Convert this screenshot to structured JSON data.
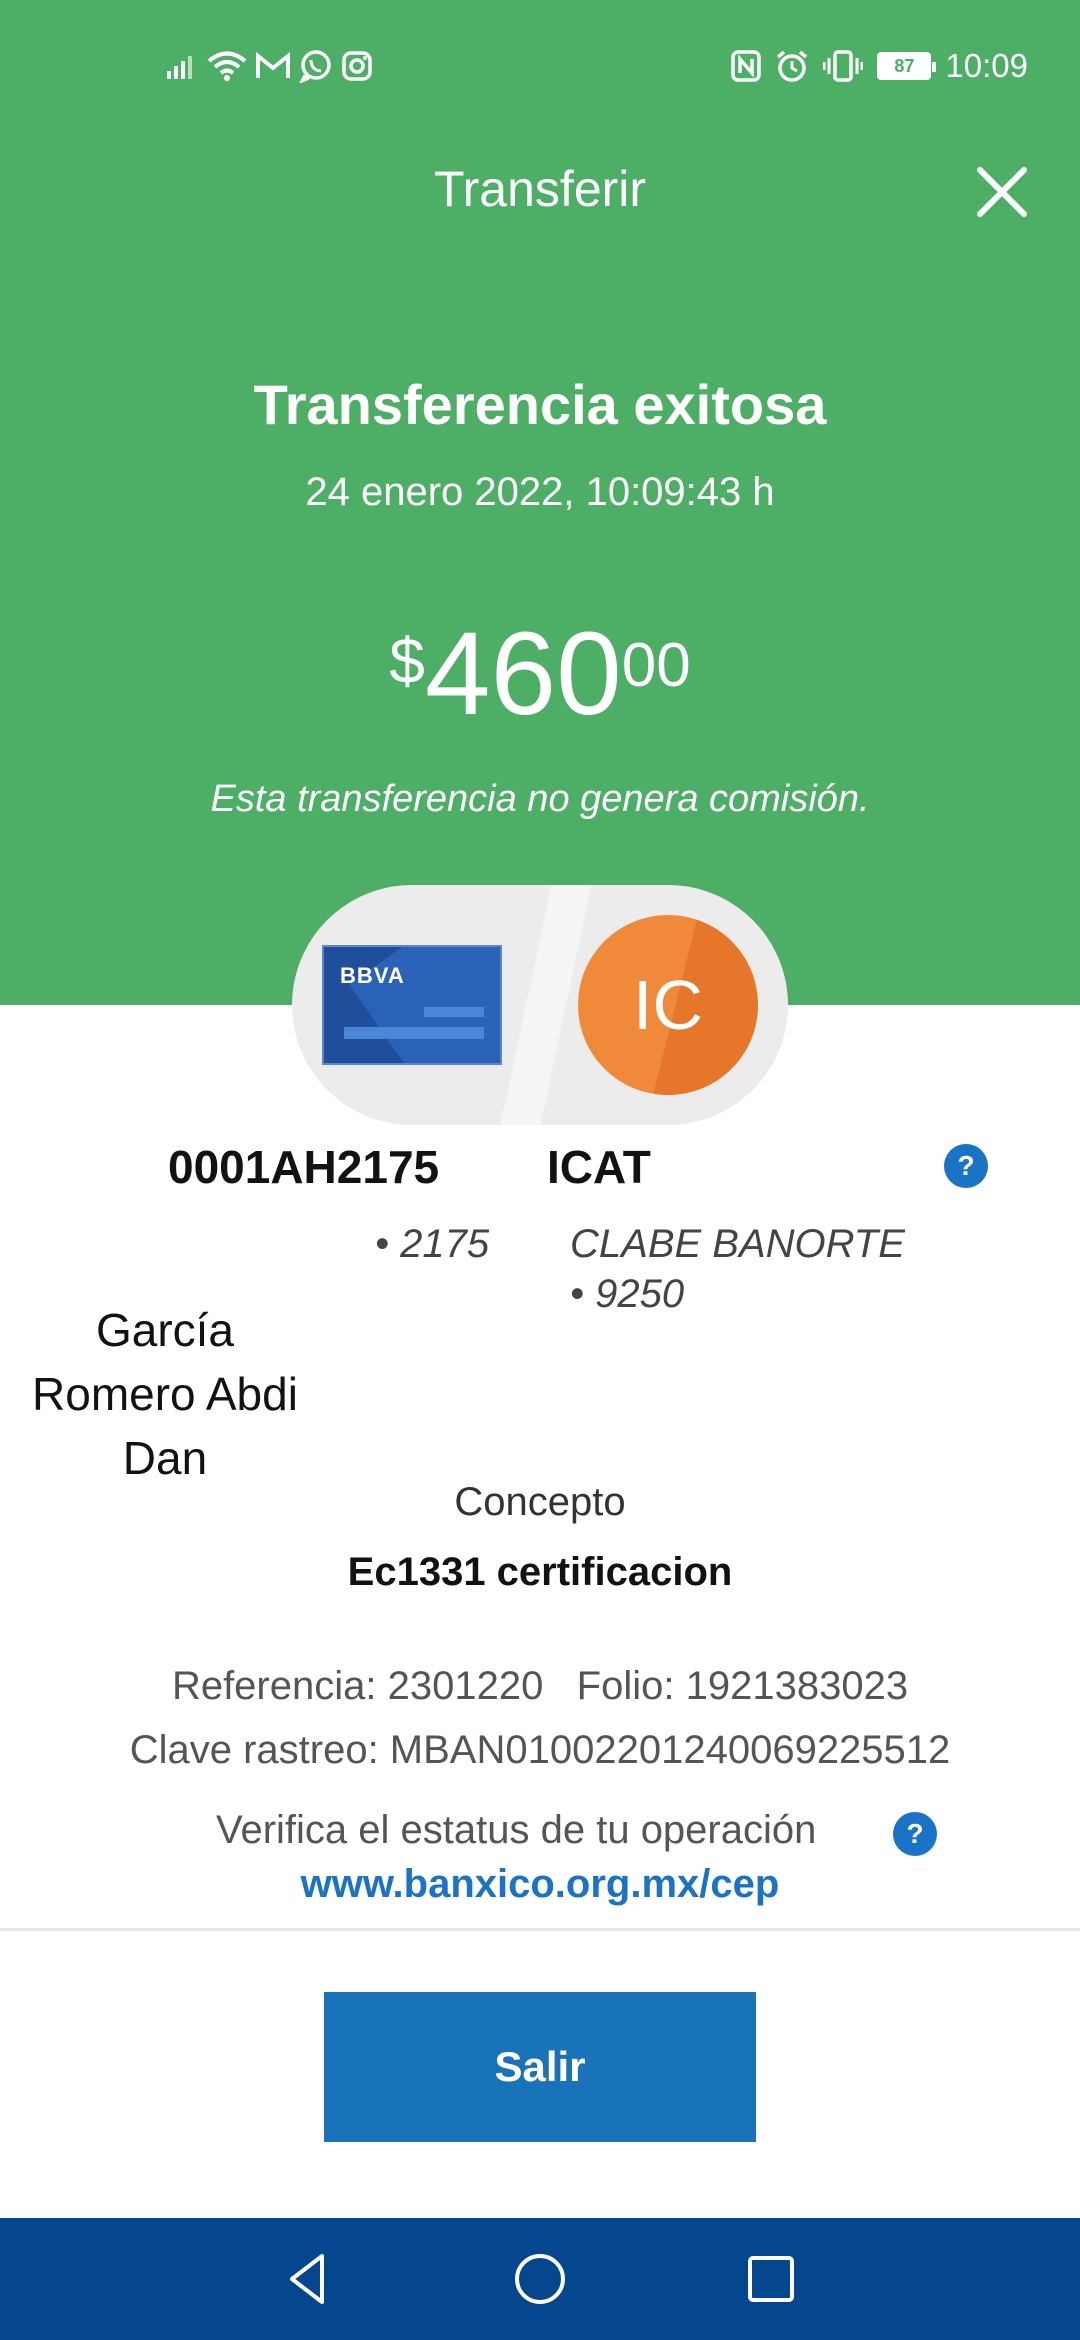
{
  "status_bar": {
    "time": "10:09",
    "battery": "87",
    "left_icons": [
      "signal-icon",
      "wifi-icon",
      "gmail-icon",
      "whatsapp-icon",
      "instagram-icon"
    ],
    "right_icons": [
      "nfc-icon",
      "alarm-icon",
      "vibrate-icon",
      "battery-icon"
    ]
  },
  "header": {
    "title": "Transferir",
    "close_icon": "close-icon"
  },
  "result": {
    "title": "Transferencia exitosa",
    "datetime": "24 enero 2022, 10:09:43 h",
    "amount_currency": "$",
    "amount_integer": "460",
    "amount_decimals": "00",
    "commission_note": "Esta transferencia no genera comisión."
  },
  "origin": {
    "card_brand": "BBVA",
    "account_number": "0001AH2175",
    "last_digits": "• 2175",
    "holder_name": "García Romero Abdi Dan"
  },
  "destination": {
    "initials": "IC",
    "name": "ICAT",
    "bank_label": "CLABE BANORTE",
    "last_digits": "• 9250"
  },
  "concept": {
    "label": "Concepto",
    "value": "Ec1331 certificacion"
  },
  "details": {
    "reference": "Referencia: 2301220",
    "folio": "Folio: 1921383023",
    "tracking_key": "Clave rastreo: MBAN01002201240069225512"
  },
  "verify": {
    "text": "Verifica el estatus de tu operación",
    "link": "www.banxico.org.mx/cep"
  },
  "actions": {
    "exit_label": "Salir"
  },
  "navigation": {
    "back": "back-icon",
    "home": "home-icon",
    "recents": "recents-icon"
  },
  "colors": {
    "green": "#4caf65",
    "blue_button": "#1973b8",
    "nav_bar": "#05478f",
    "link_blue": "#1a73c7",
    "avatar_orange": "#f0893a"
  }
}
